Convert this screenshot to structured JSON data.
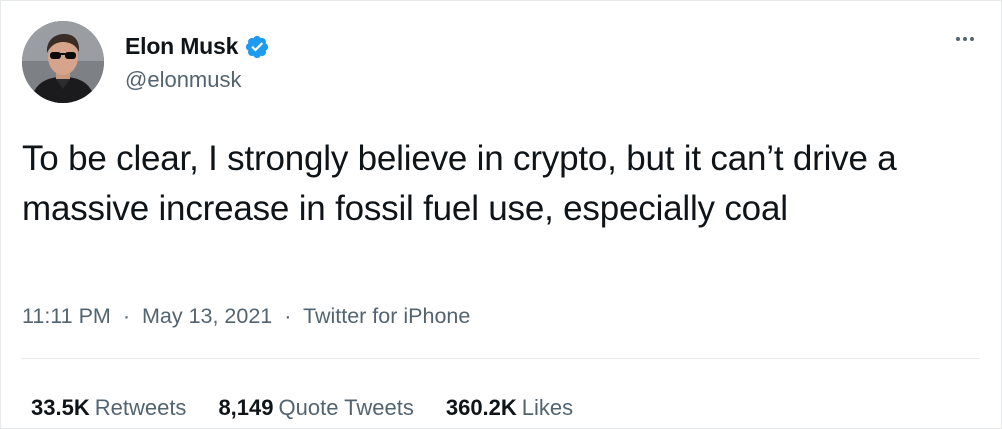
{
  "user": {
    "display_name": "Elon Musk",
    "handle": "@elonmusk",
    "verified": true,
    "avatar_icon": "profile-photo"
  },
  "tweet": {
    "text": "To be clear, I strongly believe in crypto, but it can’t drive a massive increase in fossil fuel use, especially coal"
  },
  "meta": {
    "time": "11:11 PM",
    "separator": "·",
    "date": "May 13, 2021",
    "source": "Twitter for iPhone"
  },
  "stats": {
    "retweets_count": "33.5K",
    "retweets_label": "Retweets",
    "quotes_count": "8,149",
    "quotes_label": "Quote Tweets",
    "likes_count": "360.2K",
    "likes_label": "Likes"
  },
  "colors": {
    "verified_blue": "#1d9bf0",
    "text_primary": "#0f1419",
    "text_secondary": "#536471"
  },
  "icons": {
    "more": "more-horizontal-icon",
    "verified": "verified-badge-icon"
  }
}
